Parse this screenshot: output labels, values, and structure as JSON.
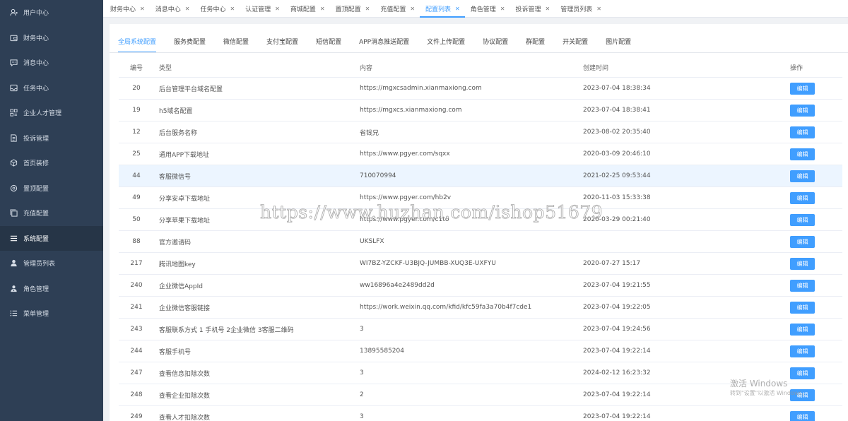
{
  "sidebar": {
    "items": [
      {
        "label": "用户中心",
        "icon": "user-icon"
      },
      {
        "label": "财务中心",
        "icon": "wallet-icon"
      },
      {
        "label": "消息中心",
        "icon": "message-icon"
      },
      {
        "label": "任务中心",
        "icon": "inbox-icon"
      },
      {
        "label": "企业人才管理",
        "icon": "grid-icon"
      },
      {
        "label": "投诉管理",
        "icon": "document-icon"
      },
      {
        "label": "首页装修",
        "icon": "cube-icon"
      },
      {
        "label": "置顶配置",
        "icon": "gear-icon"
      },
      {
        "label": "充值配置",
        "icon": "copy-icon"
      },
      {
        "label": "系统配置",
        "icon": "menu-icon"
      },
      {
        "label": "管理员列表",
        "icon": "person-icon"
      },
      {
        "label": "角色管理",
        "icon": "role-icon"
      },
      {
        "label": "菜单管理",
        "icon": "list-icon"
      }
    ],
    "active_index": 9
  },
  "top_tabs": [
    "财务中心",
    "消息中心",
    "任务中心",
    "认证管理",
    "商城配置",
    "置顶配置",
    "充值配置",
    "配置列表",
    "角色管理",
    "投诉管理",
    "管理员列表"
  ],
  "top_tabs_active": 7,
  "sub_tabs": [
    "全局系统配置",
    "服务费配置",
    "微信配置",
    "支付宝配置",
    "短信配置",
    "APP消息推送配置",
    "文件上传配置",
    "协议配置",
    "群配置",
    "开关配置",
    "图片配置"
  ],
  "sub_tabs_active": 0,
  "table": {
    "headers": {
      "id": "编号",
      "type": "类型",
      "content": "内容",
      "time": "创建时间",
      "op": "操作"
    },
    "edit_label": "编辑",
    "highlight_row": 4,
    "rows": [
      {
        "id": "20",
        "type": "后台管理平台域名配置",
        "content": "https://mgxcsadmin.xianmaxiong.com",
        "time": "2023-07-04 18:38:34"
      },
      {
        "id": "19",
        "type": "h5域名配置",
        "content": "https://mgxcs.xianmaxiong.com",
        "time": "2023-07-04 18:38:41"
      },
      {
        "id": "12",
        "type": "后台服务名称",
        "content": "省钱兄",
        "time": "2023-08-02 20:35:40"
      },
      {
        "id": "25",
        "type": "通用APP下载地址",
        "content": "https://www.pgyer.com/sqxx",
        "time": "2020-03-09 20:46:10"
      },
      {
        "id": "44",
        "type": "客服微信号",
        "content": "710070994",
        "time": "2021-02-25 09:53:44"
      },
      {
        "id": "49",
        "type": "分享安卓下载地址",
        "content": "https://www.pgyer.com/hb2v",
        "time": "2020-11-03 15:33:38"
      },
      {
        "id": "50",
        "type": "分享苹果下载地址",
        "content": "https://www.pgyer.com/c1to",
        "time": "2020-03-29 00:21:40"
      },
      {
        "id": "88",
        "type": "官方邀请码",
        "content": "UKSLFX",
        "time": ""
      },
      {
        "id": "217",
        "type": "腾讯地图key",
        "content": "WI7BZ-YZCKF-U3BJQ-JUMBB-XUQ3E-UXFYU",
        "time": "2020-07-27 15:17"
      },
      {
        "id": "240",
        "type": "企业微信AppId",
        "content": "ww16896a4e2489dd2d",
        "time": "2023-07-04 19:21:55"
      },
      {
        "id": "241",
        "type": "企业微信客服链接",
        "content": "https://work.weixin.qq.com/kfid/kfc59fa3a70b4f7cde1",
        "time": "2023-07-04 19:22:05"
      },
      {
        "id": "243",
        "type": "客服联系方式 1 手机号 2企业微信 3客服二维码",
        "content": "3",
        "time": "2023-07-04 19:24:56"
      },
      {
        "id": "244",
        "type": "客服手机号",
        "content": "13895585204",
        "time": "2023-07-04 19:22:14"
      },
      {
        "id": "247",
        "type": "查看信息扣除次数",
        "content": "3",
        "time": "2024-02-12 16:23:32"
      },
      {
        "id": "248",
        "type": "查看企业扣除次数",
        "content": "2",
        "time": "2023-07-04 19:22:14"
      },
      {
        "id": "249",
        "type": "查看人才扣除次数",
        "content": "3",
        "time": "2023-07-04 19:22:14"
      }
    ]
  },
  "watermark": "https://www.huzhan.com/ishop51679",
  "os_activation": {
    "title": "激活 Windows",
    "subtitle": "转到\"设置\"以激活 Windows。"
  }
}
